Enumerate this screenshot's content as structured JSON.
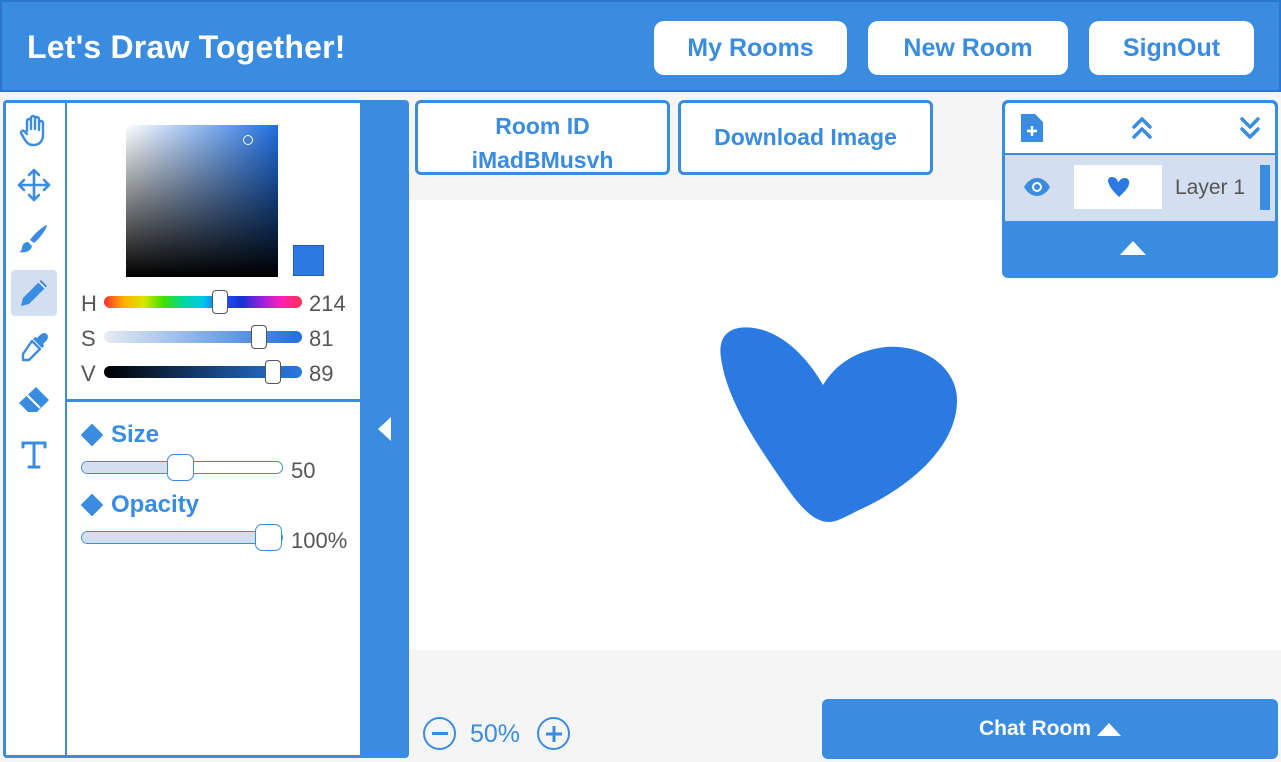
{
  "header": {
    "title": "Let's Draw Together!",
    "buttons": {
      "my_rooms": "My Rooms",
      "new_room": "New Room",
      "sign_out": "SignOut"
    }
  },
  "tools": [
    "hand-icon",
    "move-icon",
    "brush-icon",
    "pencil-icon",
    "eyedropper-icon",
    "eraser-icon",
    "text-icon"
  ],
  "active_tool": "pencil-icon",
  "color": {
    "h_label": "H",
    "h_value": "214",
    "s_label": "S",
    "s_value": "81",
    "v_label": "V",
    "v_value": "89",
    "swatch": "#2a7ae2"
  },
  "brush": {
    "size_label": "Size",
    "size_value": "50",
    "opacity_label": "Opacity",
    "opacity_value": "100%"
  },
  "room": {
    "id_label": "Room ID",
    "id_value": "iMadBMusvh",
    "download_label": "Download Image"
  },
  "layers": {
    "tools": [
      "add-layer-icon",
      "move-layer-up-icon",
      "move-layer-down-icon"
    ],
    "items": [
      {
        "name": "Layer 1",
        "visible": true
      }
    ]
  },
  "zoom": {
    "label": "50%"
  },
  "chat": {
    "label": "Chat Room"
  },
  "colors": {
    "accent": "#3a8ce0",
    "selection": "#d3dff0",
    "stroke": "#2a7ae2"
  }
}
